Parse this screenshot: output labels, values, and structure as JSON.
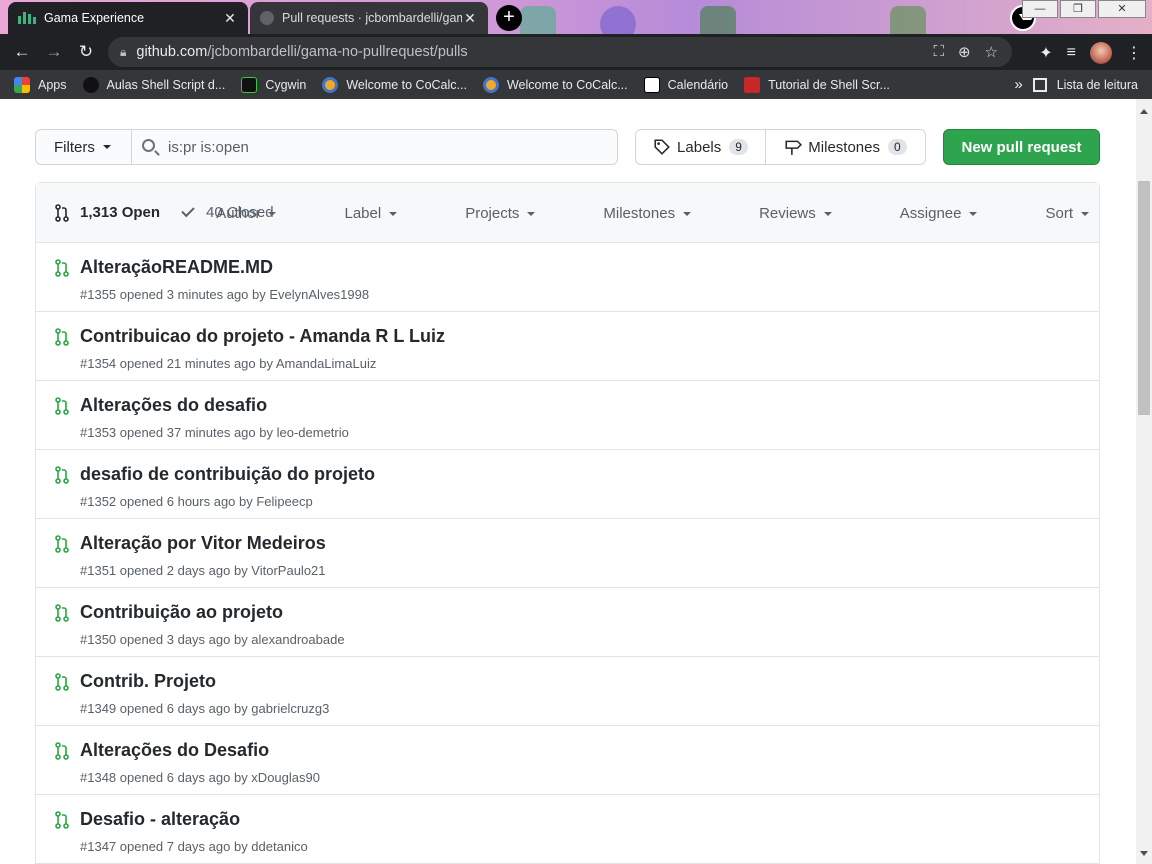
{
  "browser": {
    "tabs": [
      {
        "title": "Gama Experience",
        "active": true
      },
      {
        "title": "Pull requests · jcbombardelli/gama-",
        "active": false
      }
    ],
    "url_host": "github.com",
    "url_path": "/jcbombardelli/gama-no-pullrequest/pulls",
    "bookmarks": [
      "Apps",
      "Aulas Shell Script d...",
      "Cygwin",
      "Welcome to CoCalc...",
      "Welcome to CoCalc...",
      "Calendário",
      "Tutorial de Shell Scr..."
    ],
    "reading_list": "Lista de leitura",
    "more_bookmarks": "»"
  },
  "toolbar": {
    "filters_label": "Filters",
    "search_value": "is:pr is:open",
    "labels_label": "Labels",
    "labels_count": "9",
    "milestones_label": "Milestones",
    "milestones_count": "0",
    "new_pr_label": "New pull request"
  },
  "list_header": {
    "open_label": "1,313 Open",
    "closed_label": "40 Closed",
    "filters": [
      "Author",
      "Label",
      "Projects",
      "Milestones",
      "Reviews",
      "Assignee",
      "Sort"
    ]
  },
  "pull_requests": [
    {
      "title": "AlteraçãoREADME.MD",
      "meta": "#1355 opened 3 minutes ago by EvelynAlves1998"
    },
    {
      "title": "Contribuicao do projeto - Amanda R L Luiz",
      "meta": "#1354 opened 21 minutes ago by AmandaLimaLuiz"
    },
    {
      "title": "Alterações do desafio",
      "meta": "#1353 opened 37 minutes ago by leo-demetrio"
    },
    {
      "title": "desafio de contribuição do projeto",
      "meta": "#1352 opened 6 hours ago by Felipeecp"
    },
    {
      "title": "Alteração por Vitor Medeiros",
      "meta": "#1351 opened 2 days ago by VitorPaulo21"
    },
    {
      "title": "Contribuição ao projeto",
      "meta": "#1350 opened 3 days ago by alexandroabade"
    },
    {
      "title": "Contrib. Projeto",
      "meta": "#1349 opened 6 days ago by gabrielcruzg3"
    },
    {
      "title": "Alterações do Desafio",
      "meta": "#1348 opened 6 days ago by xDouglas90"
    },
    {
      "title": "Desafio - alteração",
      "meta": "#1347 opened 7 days ago by ddetanico"
    }
  ],
  "colors": {
    "accent_green": "#2ea44f",
    "pr_open_green": "#28a745"
  }
}
